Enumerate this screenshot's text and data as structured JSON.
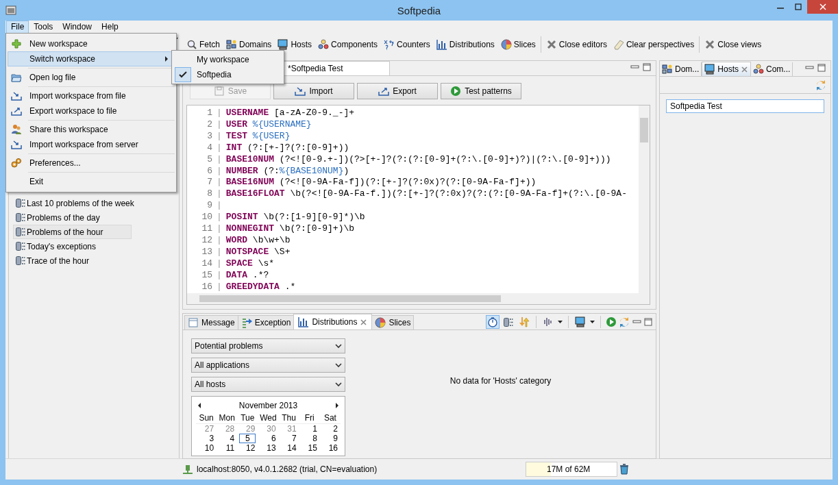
{
  "window": {
    "title": "Softpedia"
  },
  "menu_bar": [
    {
      "label": "File",
      "selected": true
    },
    {
      "label": "Tools",
      "selected": false
    },
    {
      "label": "Window",
      "selected": false
    },
    {
      "label": "Help",
      "selected": false
    }
  ],
  "file_menu": {
    "groups": [
      [
        {
          "label": "New workspace",
          "kind": "item",
          "selected": false
        },
        {
          "label": "Switch workspace",
          "kind": "submenu",
          "selected": true
        }
      ],
      [
        {
          "label": "Open log file",
          "kind": "item",
          "selected": false
        }
      ],
      [
        {
          "label": "Import workspace from file",
          "kind": "item",
          "selected": false
        },
        {
          "label": "Export workspace to file",
          "kind": "item",
          "selected": false
        }
      ],
      [
        {
          "label": "Share this workspace",
          "kind": "item",
          "selected": false
        },
        {
          "label": "Import workspace from server",
          "kind": "item",
          "selected": false
        }
      ],
      [
        {
          "label": "Preferences...",
          "kind": "item",
          "selected": false
        }
      ],
      [
        {
          "label": "Exit",
          "kind": "item",
          "selected": false
        }
      ]
    ]
  },
  "switch_submenu": [
    {
      "label": "My workspace",
      "checked": false
    },
    {
      "label": "Softpedia",
      "checked": true
    }
  ],
  "toolbar": {
    "groups": [
      [
        "Fetch",
        "Domains",
        "Hosts",
        "Components",
        "Counters",
        "Distributions",
        "Slices"
      ],
      [
        "Close editors",
        "Clear perspectives"
      ],
      [
        "Close views"
      ]
    ]
  },
  "sidebar": {
    "items": [
      {
        "label": "Last 10 problems of the week",
        "selected": false
      },
      {
        "label": "Problems of the day",
        "selected": false
      },
      {
        "label": "Problems of the hour",
        "selected": true
      },
      {
        "label": "Today's exceptions",
        "selected": false
      },
      {
        "label": "Trace of the hour",
        "selected": false
      }
    ]
  },
  "editor": {
    "tabs": [
      {
        "label": "*Softpedia Test",
        "selected": true
      }
    ],
    "buttons": [
      {
        "label": "Save",
        "disabled": true
      },
      {
        "label": "Import",
        "disabled": false
      },
      {
        "label": "Export",
        "disabled": false
      },
      {
        "label": "Test patterns",
        "disabled": false
      }
    ],
    "lines": [
      {
        "number": "1",
        "separator": "|",
        "keyword": "USERNAME",
        "pattern": [
          {
            "text": "[a-zA-Z0-9._-]+",
            "kind": "plain"
          }
        ]
      },
      {
        "number": "2",
        "separator": "|",
        "keyword": "USER",
        "pattern": [
          {
            "text": "%{USERNAME}",
            "kind": "ref"
          }
        ]
      },
      {
        "number": "3",
        "separator": "|",
        "keyword": "TEST",
        "pattern": [
          {
            "text": "%{USER}",
            "kind": "ref"
          }
        ]
      },
      {
        "number": "4",
        "separator": "|",
        "keyword": "INT",
        "pattern": [
          {
            "text": "(?:[+-]?(?:[0-9]+))",
            "kind": "plain"
          }
        ]
      },
      {
        "number": "5",
        "separator": "|",
        "keyword": "BASE10NUM",
        "pattern": [
          {
            "text": "(?<![0-9.+-])(?>[+-]?(?:(?:[0-9]+(?:\\.[0-9]+)?)|(?:\\.[0-9]+)))",
            "kind": "plain"
          }
        ]
      },
      {
        "number": "6",
        "separator": "|",
        "keyword": "NUMBER",
        "pattern": [
          {
            "text": "(?:",
            "kind": "plain"
          },
          {
            "text": "%{BASE10NUM}",
            "kind": "ref"
          },
          {
            "text": ")",
            "kind": "plain"
          }
        ]
      },
      {
        "number": "7",
        "separator": "|",
        "keyword": "BASE16NUM",
        "pattern": [
          {
            "text": "(?<![0-9A-Fa-f])(?:[+-]?(?:0x)?(?:[0-9A-Fa-f]+))",
            "kind": "plain"
          }
        ]
      },
      {
        "number": "8",
        "separator": "|",
        "keyword": "BASE16FLOAT",
        "pattern": [
          {
            "text": "\\b(?<![0-9A-Fa-f.])(?:[+-]?(?:0x)?(?:(?:[0-9A-Fa-f]+(?:\\.[0-9A-",
            "kind": "plain"
          }
        ]
      },
      {
        "number": "9",
        "separator": "|"
      },
      {
        "number": "10",
        "separator": "|",
        "keyword": "POSINT",
        "pattern": [
          {
            "text": "\\b(?:[1-9][0-9]*)\\b",
            "kind": "plain"
          }
        ]
      },
      {
        "number": "11",
        "separator": "|",
        "keyword": "NONNEGINT",
        "pattern": [
          {
            "text": "\\b(?:[0-9]+)\\b",
            "kind": "plain"
          }
        ]
      },
      {
        "number": "12",
        "separator": "|",
        "keyword": "WORD",
        "pattern": [
          {
            "text": "\\b\\w+\\b",
            "kind": "plain"
          }
        ]
      },
      {
        "number": "13",
        "separator": "|",
        "keyword": "NOTSPACE",
        "pattern": [
          {
            "text": "\\S+",
            "kind": "plain"
          }
        ]
      },
      {
        "number": "14",
        "separator": "|",
        "keyword": "SPACE",
        "pattern": [
          {
            "text": "\\s*",
            "kind": "plain"
          }
        ]
      },
      {
        "number": "15",
        "separator": "|",
        "keyword": "DATA",
        "pattern": [
          {
            "text": ".*?",
            "kind": "plain"
          }
        ]
      },
      {
        "number": "16",
        "separator": "|",
        "keyword": "GREEDYDATA",
        "pattern": [
          {
            "text": ".*",
            "kind": "plain"
          }
        ]
      }
    ]
  },
  "bottom_panel": {
    "tabs": [
      {
        "label": "Message",
        "selected": false
      },
      {
        "label": "Exception",
        "selected": false
      },
      {
        "label": "Distributions",
        "selected": true
      },
      {
        "label": "Slices",
        "selected": false
      }
    ],
    "view_tools": [
      {
        "on": true
      },
      {
        "on": false
      },
      {
        "on": false
      },
      {
        "on": false
      },
      {
        "on": false
      },
      {
        "on": false
      },
      {
        "on": false
      }
    ],
    "filters": [
      "Potential problems",
      "All applications",
      "All hosts"
    ],
    "calendar": {
      "month": "November 2013",
      "weekdays": [
        "Sun",
        "Mon",
        "Tue",
        "Wed",
        "Thu",
        "Fri",
        "Sat"
      ],
      "weeks": [
        [
          {
            "day": "27",
            "kind": "other",
            "selected": false
          },
          {
            "day": "28",
            "kind": "other",
            "selected": false
          },
          {
            "day": "29",
            "kind": "other",
            "selected": false
          },
          {
            "day": "30",
            "kind": "other",
            "selected": false
          },
          {
            "day": "31",
            "kind": "other",
            "selected": false
          },
          {
            "day": "1",
            "kind": "current",
            "selected": false
          },
          {
            "day": "2",
            "kind": "current",
            "selected": false
          }
        ],
        [
          {
            "day": "3",
            "kind": "current",
            "selected": false
          },
          {
            "day": "4",
            "kind": "current",
            "selected": false
          },
          {
            "day": "5",
            "kind": "current",
            "selected": true
          },
          {
            "day": "6",
            "kind": "current",
            "selected": false
          },
          {
            "day": "7",
            "kind": "current",
            "selected": false
          },
          {
            "day": "8",
            "kind": "current",
            "selected": false
          },
          {
            "day": "9",
            "kind": "current",
            "selected": false
          }
        ],
        [
          {
            "day": "10",
            "kind": "current",
            "selected": false
          },
          {
            "day": "11",
            "kind": "current",
            "selected": false
          },
          {
            "day": "12",
            "kind": "current",
            "selected": false
          },
          {
            "day": "13",
            "kind": "current",
            "selected": false
          },
          {
            "day": "14",
            "kind": "current",
            "selected": false
          },
          {
            "day": "15",
            "kind": "current",
            "selected": false
          },
          {
            "day": "16",
            "kind": "current",
            "selected": false
          }
        ]
      ]
    },
    "message": "No data for 'Hosts' category"
  },
  "hosts_panel": {
    "tabs": [
      {
        "label": "Dom...",
        "selected": false
      },
      {
        "label": "Hosts",
        "selected": true
      },
      {
        "label": "Com...",
        "selected": false
      }
    ],
    "field_value": "Softpedia Test"
  },
  "status_bar": {
    "connection": "localhost:8050, v4.0.1.2682 (trial, CN=evaluation)",
    "memory": {
      "reading": "17M of 62M",
      "level": 0.27
    }
  }
}
